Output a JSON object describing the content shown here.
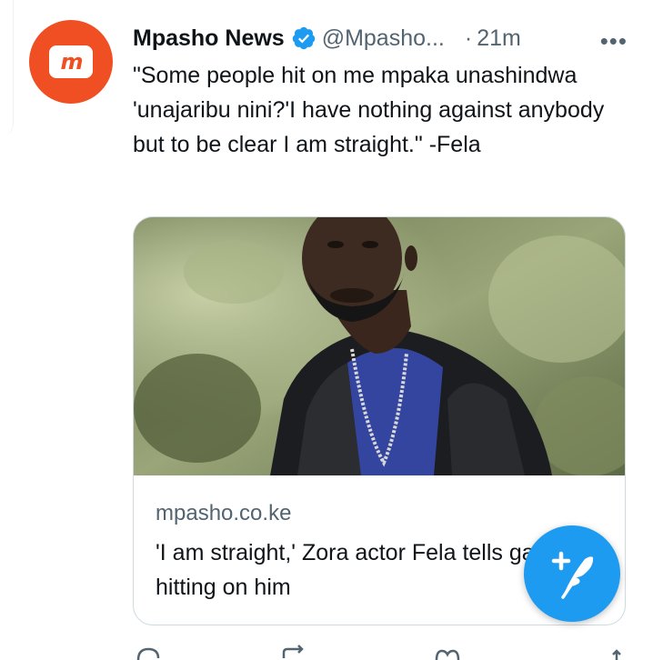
{
  "tweet": {
    "author_name": "Mpasho News",
    "handle": "@Mpasho...",
    "separator": "·",
    "time": "21m",
    "more_label": "•••",
    "avatar_logo_text": "m",
    "text": "\"Some people hit on me mpaka unashindwa 'unajaribu nini?'I have nothing against anybody but to be clear I am straight.\" -Fela"
  },
  "link_card": {
    "domain": "mpasho.co.ke",
    "title": "'I am straight,' Zora actor Fela tells gay men hitting on him",
    "image_icon": "man-in-leather-jacket-photo"
  },
  "compose_button": {
    "icon": "compose-tweet-icon"
  },
  "actions": [
    {
      "icon": "reply-icon"
    },
    {
      "icon": "retweet-icon"
    },
    {
      "icon": "like-icon"
    },
    {
      "icon": "share-icon"
    }
  ],
  "colors": {
    "brand_orange": "#f04e23",
    "twitter_blue": "#1d9bf0",
    "muted_text": "#536471",
    "border": "#cfd9de"
  }
}
